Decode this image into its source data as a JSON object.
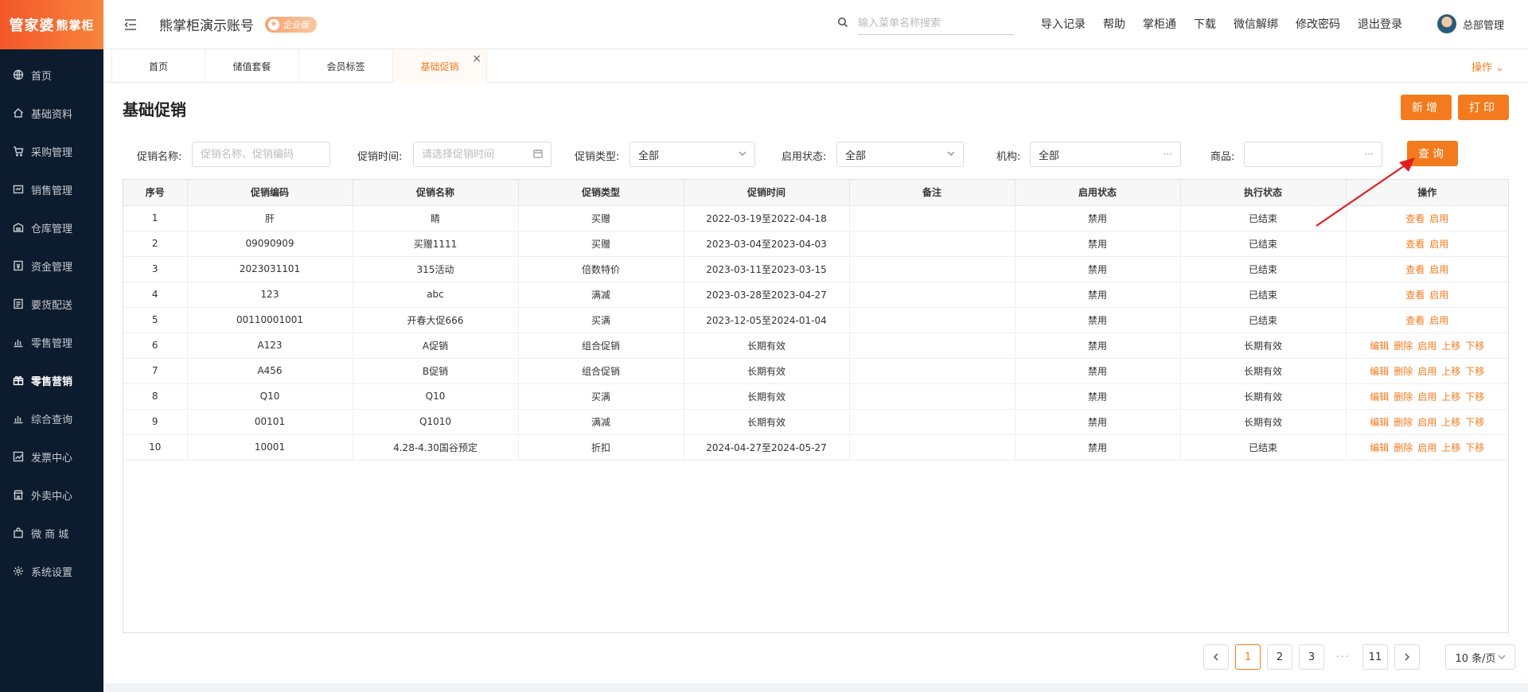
{
  "logo": {
    "main": "管家婆",
    "sub": "熊掌柜"
  },
  "sidebar": {
    "items": [
      {
        "label": "首页",
        "icon": "globe-icon"
      },
      {
        "label": "基础资料",
        "icon": "home-icon"
      },
      {
        "label": "采购管理",
        "icon": "cart-icon"
      },
      {
        "label": "销售管理",
        "icon": "sales-icon"
      },
      {
        "label": "仓库管理",
        "icon": "warehouse-icon"
      },
      {
        "label": "资金管理",
        "icon": "money-icon"
      },
      {
        "label": "要货配送",
        "icon": "list-icon"
      },
      {
        "label": "零售管理",
        "icon": "bar-chart-icon"
      },
      {
        "label": "零售营销",
        "icon": "gift-icon"
      },
      {
        "label": "综合查询",
        "icon": "bar-chart-icon"
      },
      {
        "label": "发票中心",
        "icon": "trend-icon"
      },
      {
        "label": "外卖中心",
        "icon": "store-icon"
      },
      {
        "label": "微 商 城",
        "icon": "bag-icon"
      },
      {
        "label": "系统设置",
        "icon": "gear-icon"
      }
    ],
    "active_index": 8
  },
  "header": {
    "account": "熊掌柜演示账号",
    "badge": "企业版",
    "search_placeholder": "输入菜单名称搜索",
    "links": [
      "导入记录",
      "帮助",
      "掌柜通",
      "下载",
      "微信解绑",
      "修改密码",
      "退出登录"
    ],
    "user": "总部管理"
  },
  "tabs": {
    "items": [
      "首页",
      "储值套餐",
      "会员标签",
      "基础促销"
    ],
    "active_index": 3,
    "close": "×",
    "ops": "操作"
  },
  "page": {
    "title": "基础促销",
    "btn_new": "新增",
    "btn_print": "打印",
    "btn_query": "查询"
  },
  "filters": {
    "name_label": "促销名称:",
    "name_placeholder": "促销名称、促销编码",
    "time_label": "促销时间:",
    "time_placeholder": "请选择促销时间",
    "type_label": "促销类型:",
    "type_value": "全部",
    "status_label": "启用状态:",
    "status_value": "全部",
    "org_label": "机构:",
    "org_value": "全部",
    "goods_label": "商品:",
    "more": "···"
  },
  "table": {
    "headers": [
      "序号",
      "促销编码",
      "促销名称",
      "促销类型",
      "促销时间",
      "备注",
      "启用状态",
      "执行状态",
      "操作"
    ],
    "rows": [
      {
        "no": "1",
        "code": "肝",
        "name": "睛",
        "type": "买赠",
        "time": "2022-03-19至2022-04-18",
        "note": "",
        "enabled": "禁用",
        "exec": "已结束",
        "actions": [
          "查看",
          "启用"
        ]
      },
      {
        "no": "2",
        "code": "09090909",
        "name": "买赠1111",
        "type": "买赠",
        "time": "2023-03-04至2023-04-03",
        "note": "",
        "enabled": "禁用",
        "exec": "已结束",
        "actions": [
          "查看",
          "启用"
        ]
      },
      {
        "no": "3",
        "code": "2023031101",
        "name": "315活动",
        "type": "倍数特价",
        "time": "2023-03-11至2023-03-15",
        "note": "",
        "enabled": "禁用",
        "exec": "已结束",
        "actions": [
          "查看",
          "启用"
        ]
      },
      {
        "no": "4",
        "code": "123",
        "name": "abc",
        "type": "满减",
        "time": "2023-03-28至2023-04-27",
        "note": "",
        "enabled": "禁用",
        "exec": "已结束",
        "actions": [
          "查看",
          "启用"
        ]
      },
      {
        "no": "5",
        "code": "00110001001",
        "name": "开春大促666",
        "type": "买满",
        "time": "2023-12-05至2024-01-04",
        "note": "",
        "enabled": "禁用",
        "exec": "已结束",
        "actions": [
          "查看",
          "启用"
        ]
      },
      {
        "no": "6",
        "code": "A123",
        "name": "A促销",
        "type": "组合促销",
        "time": "长期有效",
        "note": "",
        "enabled": "禁用",
        "exec": "长期有效",
        "actions": [
          "编辑",
          "删除",
          "启用",
          "上移",
          "下移"
        ]
      },
      {
        "no": "7",
        "code": "A456",
        "name": "B促销",
        "type": "组合促销",
        "time": "长期有效",
        "note": "",
        "enabled": "禁用",
        "exec": "长期有效",
        "actions": [
          "编辑",
          "删除",
          "启用",
          "上移",
          "下移"
        ]
      },
      {
        "no": "8",
        "code": "Q10",
        "name": "Q10",
        "type": "买满",
        "time": "长期有效",
        "note": "",
        "enabled": "禁用",
        "exec": "长期有效",
        "actions": [
          "编辑",
          "删除",
          "启用",
          "上移",
          "下移"
        ]
      },
      {
        "no": "9",
        "code": "00101",
        "name": "Q1010",
        "type": "满减",
        "time": "长期有效",
        "note": "",
        "enabled": "禁用",
        "exec": "长期有效",
        "actions": [
          "编辑",
          "删除",
          "启用",
          "上移",
          "下移"
        ]
      },
      {
        "no": "10",
        "code": "10001",
        "name": "4.28-4.30国谷预定",
        "type": "折扣",
        "time": "2024-04-27至2024-05-27",
        "note": "",
        "enabled": "禁用",
        "exec": "已结束",
        "actions": [
          "编辑",
          "删除",
          "启用",
          "上移",
          "下移"
        ]
      }
    ]
  },
  "pagination": {
    "pages": [
      "1",
      "2",
      "3"
    ],
    "ellipsis": "···",
    "last": "11",
    "current": "1",
    "page_size": "10 条/页"
  },
  "colors": {
    "accent": "#f37b1d",
    "sidebar": "#0d1b2e"
  }
}
